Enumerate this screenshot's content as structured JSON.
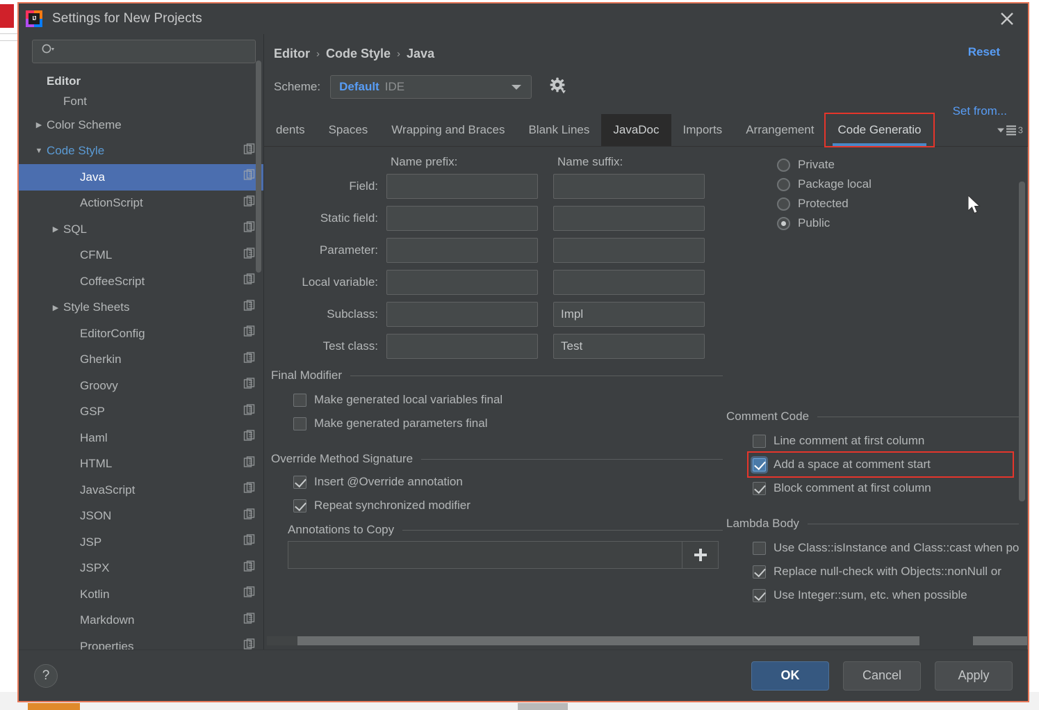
{
  "window": {
    "title": "Settings for New Projects",
    "logo_text": "IJ",
    "close_icon": "close-icon"
  },
  "search": {
    "placeholder": "",
    "value": "",
    "icon": "search-icon"
  },
  "sidebar": {
    "items": [
      {
        "label": "Editor",
        "indent": 0,
        "arrow": "",
        "group": true,
        "copy": false,
        "selected": false
      },
      {
        "label": "Font",
        "indent": 1,
        "arrow": "",
        "group": false,
        "copy": false,
        "selected": false
      },
      {
        "label": "Color Scheme",
        "indent": 0,
        "arrow": "▶",
        "group": false,
        "copy": false,
        "selected": false
      },
      {
        "label": "Code Style",
        "indent": 0,
        "arrow": "▼",
        "group": false,
        "copy": true,
        "selected": false,
        "blue": true
      },
      {
        "label": "Java",
        "indent": 2,
        "arrow": "",
        "group": false,
        "copy": true,
        "selected": true
      },
      {
        "label": "ActionScript",
        "indent": 2,
        "arrow": "",
        "group": false,
        "copy": true,
        "selected": false
      },
      {
        "label": "SQL",
        "indent": 1,
        "arrow": "▶",
        "group": false,
        "copy": true,
        "selected": false
      },
      {
        "label": "CFML",
        "indent": 2,
        "arrow": "",
        "group": false,
        "copy": true,
        "selected": false
      },
      {
        "label": "CoffeeScript",
        "indent": 2,
        "arrow": "",
        "group": false,
        "copy": true,
        "selected": false
      },
      {
        "label": "Style Sheets",
        "indent": 1,
        "arrow": "▶",
        "group": false,
        "copy": true,
        "selected": false
      },
      {
        "label": "EditorConfig",
        "indent": 2,
        "arrow": "",
        "group": false,
        "copy": true,
        "selected": false
      },
      {
        "label": "Gherkin",
        "indent": 2,
        "arrow": "",
        "group": false,
        "copy": true,
        "selected": false
      },
      {
        "label": "Groovy",
        "indent": 2,
        "arrow": "",
        "group": false,
        "copy": true,
        "selected": false
      },
      {
        "label": "GSP",
        "indent": 2,
        "arrow": "",
        "group": false,
        "copy": true,
        "selected": false
      },
      {
        "label": "Haml",
        "indent": 2,
        "arrow": "",
        "group": false,
        "copy": true,
        "selected": false
      },
      {
        "label": "HTML",
        "indent": 2,
        "arrow": "",
        "group": false,
        "copy": true,
        "selected": false
      },
      {
        "label": "JavaScript",
        "indent": 2,
        "arrow": "",
        "group": false,
        "copy": true,
        "selected": false
      },
      {
        "label": "JSON",
        "indent": 2,
        "arrow": "",
        "group": false,
        "copy": true,
        "selected": false
      },
      {
        "label": "JSP",
        "indent": 2,
        "arrow": "",
        "group": false,
        "copy": true,
        "selected": false
      },
      {
        "label": "JSPX",
        "indent": 2,
        "arrow": "",
        "group": false,
        "copy": true,
        "selected": false
      },
      {
        "label": "Kotlin",
        "indent": 2,
        "arrow": "",
        "group": false,
        "copy": true,
        "selected": false
      },
      {
        "label": "Markdown",
        "indent": 2,
        "arrow": "",
        "group": false,
        "copy": true,
        "selected": false
      },
      {
        "label": "Properties",
        "indent": 2,
        "arrow": "",
        "group": false,
        "copy": true,
        "selected": false
      }
    ]
  },
  "header": {
    "breadcrumb": [
      "Editor",
      "Code Style",
      "Java"
    ],
    "separator": "›",
    "reset_label": "Reset",
    "set_from_label": "Set from...",
    "scheme_label": "Scheme:",
    "scheme_name": "Default",
    "scheme_kind": "IDE",
    "gear_icon": "gear-icon"
  },
  "tabs": {
    "items": [
      {
        "label": "dents",
        "state": "clipped"
      },
      {
        "label": "Spaces",
        "state": "normal"
      },
      {
        "label": "Wrapping and Braces",
        "state": "normal"
      },
      {
        "label": "Blank Lines",
        "state": "normal"
      },
      {
        "label": "JavaDoc",
        "state": "dark"
      },
      {
        "label": "Imports",
        "state": "normal"
      },
      {
        "label": "Arrangement",
        "state": "normal"
      },
      {
        "label": "Code Generatio",
        "state": "selected"
      }
    ],
    "overflow_count": "3"
  },
  "naming": {
    "col_prefix": "Name prefix:",
    "col_suffix": "Name suffix:",
    "rows": [
      {
        "caption": "Field:",
        "prefix": "",
        "suffix": ""
      },
      {
        "caption": "Static field:",
        "prefix": "",
        "suffix": ""
      },
      {
        "caption": "Parameter:",
        "prefix": "",
        "suffix": ""
      },
      {
        "caption": "Local variable:",
        "prefix": "",
        "suffix": ""
      },
      {
        "caption": "Subclass:",
        "prefix": "",
        "suffix": "Impl"
      },
      {
        "caption": "Test class:",
        "prefix": "",
        "suffix": "Test"
      }
    ]
  },
  "visibility": {
    "options": [
      {
        "label": "Private",
        "checked": false
      },
      {
        "label": "Package local",
        "checked": false
      },
      {
        "label": "Protected",
        "checked": false
      },
      {
        "label": "Public",
        "checked": true
      }
    ]
  },
  "final_modifier": {
    "title": "Final Modifier",
    "options": [
      {
        "label": "Make generated local variables final",
        "checked": false
      },
      {
        "label": "Make generated parameters final",
        "checked": false
      }
    ]
  },
  "comment_code": {
    "title": "Comment Code",
    "options": [
      {
        "label": "Line comment at first column",
        "checked": false,
        "focused": false,
        "highlight": false
      },
      {
        "label": "Add a space at comment start",
        "checked": true,
        "focused": true,
        "highlight": true
      },
      {
        "label": "Block comment at first column",
        "checked": true,
        "focused": false,
        "highlight": false
      }
    ]
  },
  "override_method": {
    "title": "Override Method Signature",
    "options": [
      {
        "label": "Insert @Override annotation",
        "checked": true
      },
      {
        "label": "Repeat synchronized modifier",
        "checked": true
      }
    ],
    "annotations_title": "Annotations to Copy",
    "add_icon": "plus-icon"
  },
  "lambda_body": {
    "title": "Lambda Body",
    "options": [
      {
        "label": "Use Class::isInstance and Class::cast when po",
        "checked": false
      },
      {
        "label": "Replace null-check with Objects::nonNull or",
        "checked": true
      },
      {
        "label": "Use Integer::sum, etc. when possible",
        "checked": true
      }
    ]
  },
  "footer": {
    "help_label": "?",
    "ok_label": "OK",
    "cancel_label": "Cancel",
    "apply_label": "Apply"
  },
  "colors": {
    "accent_blue": "#4b6eaf",
    "link_blue": "#589df6",
    "tab_underline": "#4a88c7",
    "highlight_red": "#e5352b",
    "dialog_border": "#e8795a",
    "panel_bg": "#3c3f41"
  }
}
